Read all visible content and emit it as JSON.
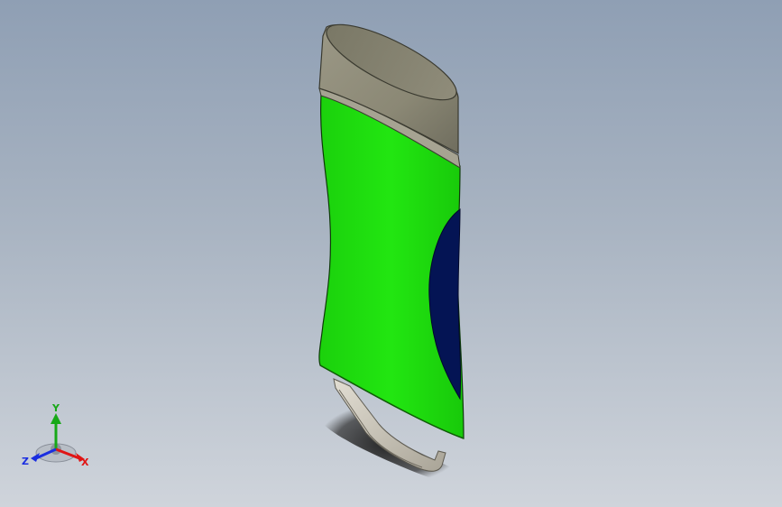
{
  "viewport": {
    "background_top": "#8f9fb4",
    "background_bottom": "#cfd4db"
  },
  "model": {
    "cap_color": "#8c8a78",
    "body_color": "#22e611",
    "window_color": "#041454",
    "clip_color": "#c8c3b6"
  },
  "triad": {
    "x_label": "X",
    "y_label": "Y",
    "z_label": "Z",
    "x_color": "#e01515",
    "y_color": "#17a817",
    "z_color": "#1a2ee0"
  }
}
